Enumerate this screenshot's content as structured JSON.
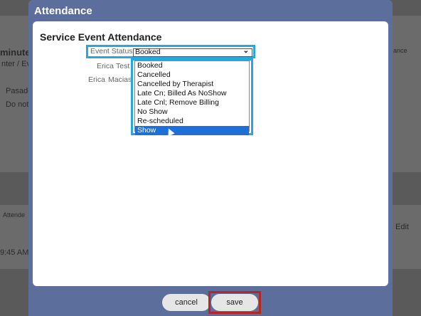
{
  "background": {
    "texts": [
      "minutes",
      "nter / Ev",
      "Pasade",
      "Do not",
      "Attende",
      "9:45 AM",
      "ance",
      "Edit"
    ]
  },
  "modal": {
    "title": "Attendance",
    "heading": "Service Event Attendance",
    "event_status_label": "Event Status",
    "selected_value": "Booked",
    "attendees": [
      {
        "first": "Erica",
        "last": "Test"
      },
      {
        "first": "Erica",
        "last": "Macias"
      }
    ],
    "options": [
      "Booked",
      "Cancelled",
      "Cancelled by Therapist",
      "Late Cn; Billed As NoShow",
      "Late Cnl; Remove Billing",
      "No Show",
      "Re-scheduled",
      "Show"
    ],
    "highlighted_option": "Show",
    "cancel_label": "cancel",
    "save_label": "save"
  },
  "colors": {
    "modal_header": "#5c6e9b",
    "highlight_outline": "#2aa6dc",
    "save_outline": "#b5281f",
    "selected_option": "#1f6fd6"
  }
}
